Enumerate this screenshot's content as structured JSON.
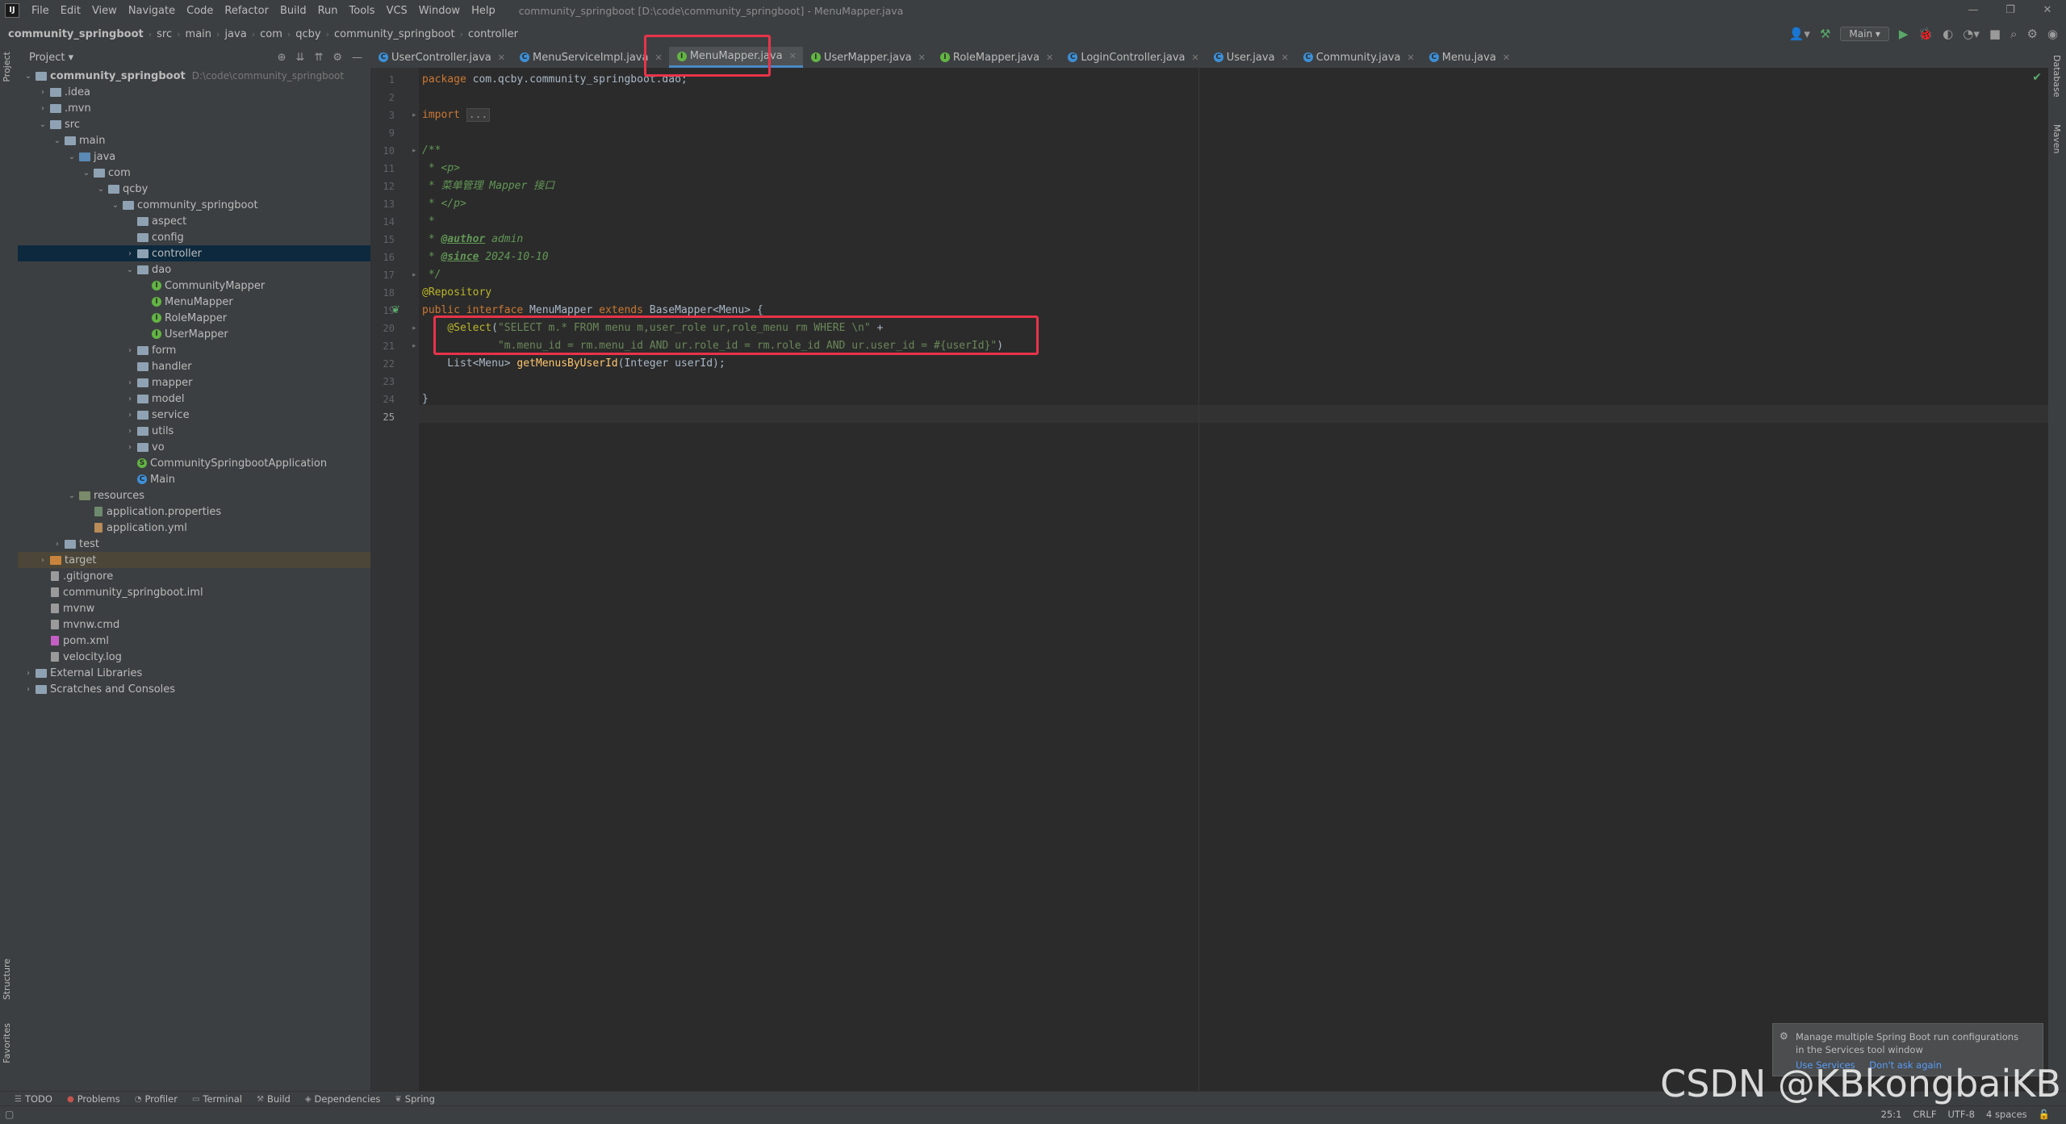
{
  "window": {
    "title": "community_springboot [D:\\code\\community_springboot] - MenuMapper.java",
    "controls": [
      "—",
      "❐",
      "✕"
    ]
  },
  "menu": [
    "File",
    "Edit",
    "View",
    "Navigate",
    "Code",
    "Refactor",
    "Build",
    "Run",
    "Tools",
    "VCS",
    "Window",
    "Help"
  ],
  "breadcrumb": [
    "community_springboot",
    "src",
    "main",
    "java",
    "com",
    "qcby",
    "community_springboot",
    "controller"
  ],
  "toolbar": {
    "run_config": "Main"
  },
  "project_panel": {
    "title": "Project"
  },
  "tree": [
    {
      "label": "community_springboot",
      "hint": "D:\\code\\community_springboot",
      "depth": 0,
      "arrow": "v",
      "icon": "folder",
      "bold": true
    },
    {
      "label": ".idea",
      "depth": 1,
      "arrow": ">",
      "icon": "folder"
    },
    {
      "label": ".mvn",
      "depth": 1,
      "arrow": ">",
      "icon": "folder"
    },
    {
      "label": "src",
      "depth": 1,
      "arrow": "v",
      "icon": "folder"
    },
    {
      "label": "main",
      "depth": 2,
      "arrow": "v",
      "icon": "folder"
    },
    {
      "label": "java",
      "depth": 3,
      "arrow": "v",
      "icon": "src"
    },
    {
      "label": "com",
      "depth": 4,
      "arrow": "v",
      "icon": "folder"
    },
    {
      "label": "qcby",
      "depth": 5,
      "arrow": "v",
      "icon": "folder"
    },
    {
      "label": "community_springboot",
      "depth": 6,
      "arrow": "v",
      "icon": "folder"
    },
    {
      "label": "aspect",
      "depth": 7,
      "arrow": "",
      "icon": "folder"
    },
    {
      "label": "config",
      "depth": 7,
      "arrow": "",
      "icon": "folder"
    },
    {
      "label": "controller",
      "depth": 7,
      "arrow": ">",
      "icon": "folder",
      "selected": true
    },
    {
      "label": "dao",
      "depth": 7,
      "arrow": "v",
      "icon": "folder"
    },
    {
      "label": "CommunityMapper",
      "depth": 8,
      "arrow": "",
      "icon": "iface"
    },
    {
      "label": "MenuMapper",
      "depth": 8,
      "arrow": "",
      "icon": "iface"
    },
    {
      "label": "RoleMapper",
      "depth": 8,
      "arrow": "",
      "icon": "iface"
    },
    {
      "label": "UserMapper",
      "depth": 8,
      "arrow": "",
      "icon": "iface"
    },
    {
      "label": "form",
      "depth": 7,
      "arrow": ">",
      "icon": "folder"
    },
    {
      "label": "handler",
      "depth": 7,
      "arrow": "",
      "icon": "folder"
    },
    {
      "label": "mapper",
      "depth": 7,
      "arrow": ">",
      "icon": "folder"
    },
    {
      "label": "model",
      "depth": 7,
      "arrow": ">",
      "icon": "folder"
    },
    {
      "label": "service",
      "depth": 7,
      "arrow": ">",
      "icon": "folder"
    },
    {
      "label": "utils",
      "depth": 7,
      "arrow": ">",
      "icon": "folder"
    },
    {
      "label": "vo",
      "depth": 7,
      "arrow": ">",
      "icon": "folder"
    },
    {
      "label": "CommunitySpringbootApplication",
      "depth": 7,
      "arrow": "",
      "icon": "spring"
    },
    {
      "label": "Main",
      "depth": 7,
      "arrow": "",
      "icon": "cls"
    },
    {
      "label": "resources",
      "depth": 3,
      "arrow": "v",
      "icon": "res"
    },
    {
      "label": "application.properties",
      "depth": 4,
      "arrow": "",
      "icon": "prop"
    },
    {
      "label": "application.yml",
      "depth": 4,
      "arrow": "",
      "icon": "yml"
    },
    {
      "label": "test",
      "depth": 2,
      "arrow": ">",
      "icon": "folder"
    },
    {
      "label": "target",
      "depth": 1,
      "arrow": ">",
      "icon": "excl",
      "excluded": true
    },
    {
      "label": ".gitignore",
      "depth": 1,
      "arrow": "",
      "icon": "file"
    },
    {
      "label": "community_springboot.iml",
      "depth": 1,
      "arrow": "",
      "icon": "file"
    },
    {
      "label": "mvnw",
      "depth": 1,
      "arrow": "",
      "icon": "file"
    },
    {
      "label": "mvnw.cmd",
      "depth": 1,
      "arrow": "",
      "icon": "file"
    },
    {
      "label": "pom.xml",
      "depth": 1,
      "arrow": "",
      "icon": "m"
    },
    {
      "label": "velocity.log",
      "depth": 1,
      "arrow": "",
      "icon": "file"
    },
    {
      "label": "External Libraries",
      "depth": 0,
      "arrow": ">",
      "icon": "lib"
    },
    {
      "label": "Scratches and Consoles",
      "depth": 0,
      "arrow": ">",
      "icon": "lib"
    }
  ],
  "tabs": [
    {
      "label": "UserController.java",
      "icon": "cls"
    },
    {
      "label": "MenuServiceImpl.java",
      "icon": "cls"
    },
    {
      "label": "MenuMapper.java",
      "icon": "iface",
      "active": true
    },
    {
      "label": "UserMapper.java",
      "icon": "iface"
    },
    {
      "label": "RoleMapper.java",
      "icon": "iface"
    },
    {
      "label": "LoginController.java",
      "icon": "cls"
    },
    {
      "label": "User.java",
      "icon": "cls"
    },
    {
      "label": "Community.java",
      "icon": "cls"
    },
    {
      "label": "Menu.java",
      "icon": "cls"
    }
  ],
  "code_lines": [
    {
      "n": "1",
      "html": "<span class='kw'>package</span> com.qcby.community_springboot.dao;"
    },
    {
      "n": "2",
      "html": ""
    },
    {
      "n": "3",
      "html": "<span class='kw'>import</span> <span class='fold'>...</span>"
    },
    {
      "n": "9",
      "html": ""
    },
    {
      "n": "10",
      "html": "<span class='cm'>/**</span>"
    },
    {
      "n": "11",
      "html": "<span class='cm'> * &lt;p&gt;</span>"
    },
    {
      "n": "12",
      "html": "<span class='cm'> * 菜单管理 Mapper 接口</span>"
    },
    {
      "n": "13",
      "html": "<span class='cm'> * &lt;/p&gt;</span>"
    },
    {
      "n": "14",
      "html": "<span class='cm'> *</span>"
    },
    {
      "n": "15",
      "html": "<span class='cm'> * </span><span class='tag'>@author</span><span class='cm'> admin</span>"
    },
    {
      "n": "16",
      "html": "<span class='cm'> * </span><span class='tag'>@since</span><span class='cm'> 2024-10-10</span>"
    },
    {
      "n": "17",
      "html": "<span class='cm'> */</span>"
    },
    {
      "n": "18",
      "html": "<span class='ann'>@Repository</span>"
    },
    {
      "n": "19",
      "html": "<span class='kw'>public interface</span> MenuMapper <span class='kw'>extends</span> BaseMapper&lt;Menu&gt; {"
    },
    {
      "n": "20",
      "html": "    <span class='ann'>@Select</span>(<span class='str'>\"SELECT m.* FROM menu m,user_role ur,role_menu rm WHERE \\n\"</span> +"
    },
    {
      "n": "21",
      "html": "            <span class='str'>\"m.menu_id = rm.menu_id AND ur.role_id = rm.role_id AND ur.user_id = #{userId}\"</span>)"
    },
    {
      "n": "22",
      "html": "    List&lt;Menu&gt; <span class='fn'>getMenusByUserId</span>(Integer userId);"
    },
    {
      "n": "23",
      "html": ""
    },
    {
      "n": "24",
      "html": "}"
    },
    {
      "n": "25",
      "html": ""
    }
  ],
  "bottom_tools": [
    {
      "label": "TODO",
      "icon": "☰"
    },
    {
      "label": "Problems",
      "icon": "●"
    },
    {
      "label": "Profiler",
      "icon": "◔"
    },
    {
      "label": "Terminal",
      "icon": "▭"
    },
    {
      "label": "Build",
      "icon": "⚒"
    },
    {
      "label": "Dependencies",
      "icon": "◈"
    },
    {
      "label": "Spring",
      "icon": "❦"
    }
  ],
  "status": {
    "position": "25:1",
    "line_sep": "CRLF",
    "encoding": "UTF-8",
    "indent": "4 spaces"
  },
  "notification": {
    "text": "Manage multiple Spring Boot run configurations in the Services tool window",
    "link1": "Use Services",
    "link2": "Don't ask again"
  },
  "left_strip": {
    "top": "Project",
    "structure": "Structure",
    "favorites": "Favorites"
  },
  "right_strip": {
    "database": "Database",
    "maven": "Maven"
  },
  "watermark": "CSDN @KBkongbaiKB"
}
